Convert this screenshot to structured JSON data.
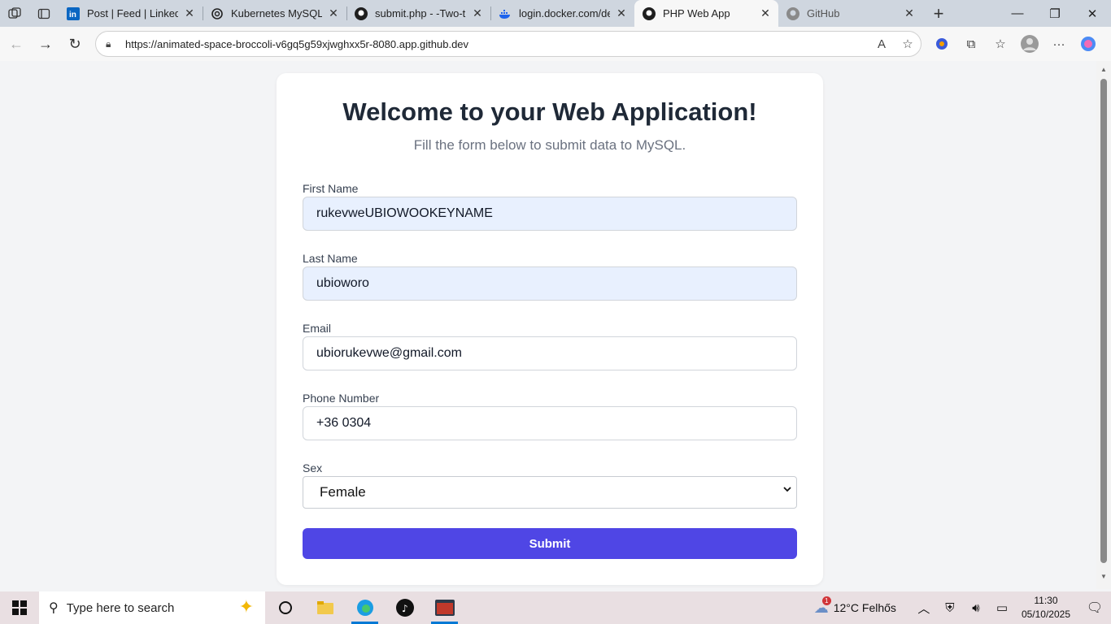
{
  "browser": {
    "tabs": [
      {
        "title": "Post | Feed | LinkedIn",
        "icon": "linkedin-icon"
      },
      {
        "title": "Kubernetes MySQL pr",
        "icon": "chatgpt-icon"
      },
      {
        "title": "submit.php - -Two-tie",
        "icon": "github-icon"
      },
      {
        "title": "login.docker.com/dev",
        "icon": "docker-icon"
      },
      {
        "title": "PHP Web App",
        "icon": "github-icon",
        "active": true
      },
      {
        "title": "GitHub",
        "icon": "github-icon"
      }
    ],
    "url": "https://animated-space-broccoli-v6gq5g59xjwghxx5r-8080.app.github.dev"
  },
  "page": {
    "heading": "Welcome to your Web Application!",
    "subtitle": "Fill the form below to submit data to MySQL.",
    "fields": {
      "first_name": {
        "label": "First Name",
        "value": "rukevweUBIOWOOKEYNAME"
      },
      "last_name": {
        "label": "Last Name",
        "value": "ubioworo"
      },
      "email": {
        "label": "Email",
        "value": "ubiorukevwe@gmail.com"
      },
      "phone": {
        "label": "Phone Number",
        "value": "+36 0304"
      },
      "sex": {
        "label": "Sex",
        "value": "Female"
      }
    },
    "submit_label": "Submit"
  },
  "colors": {
    "accent": "#4f46e5",
    "autofill": "#e8f0fe",
    "heading": "#1f2937"
  },
  "taskbar": {
    "search_placeholder": "Type here to search",
    "weather": "12°C  Felhős",
    "weather_badge": "1",
    "time": "11:30",
    "date": "05/10/2025"
  }
}
